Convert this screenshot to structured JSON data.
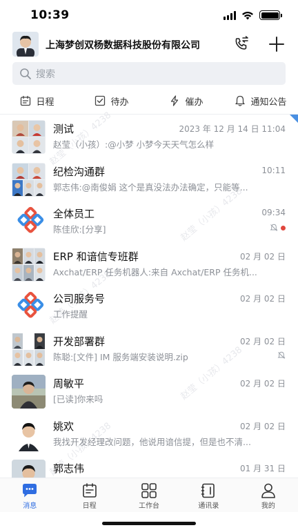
{
  "status_bar": {
    "time": "10:39"
  },
  "header": {
    "company_name": "上海梦创双杨数据科技股份有限公司",
    "call_icon": "phone-transfer-icon",
    "add_icon": "plus-icon"
  },
  "search": {
    "placeholder": "搜索"
  },
  "quick_actions": [
    {
      "label": "日程",
      "icon": "calendar-icon"
    },
    {
      "label": "待办",
      "icon": "todo-check-icon"
    },
    {
      "label": "催办",
      "icon": "lightning-icon"
    },
    {
      "label": "通知公告",
      "icon": "bell-icon"
    }
  ],
  "conversations": [
    {
      "title": "测试",
      "time": "2023 年 12 月 14 日 11:04",
      "preview": "赵莹（小孩）:@小梦 小梦今天天气怎么样"
    },
    {
      "title": "纪检沟通群",
      "time": "10:11",
      "preview": "郭志伟:@南俊娟  这个是真没法办法确定，只能等..."
    },
    {
      "title": "全体员工",
      "time": "09:34",
      "preview": "陈佳欣:[分享]"
    },
    {
      "title": "ERP 和谙信专班群",
      "time": "02 月 02 日",
      "preview": "Axchat/ERP 任务机器人:来自 Axchat/ERP 任务机..."
    },
    {
      "title": "公司服务号",
      "time": "02 月 02 日",
      "preview": "工作提醒"
    },
    {
      "title": "开发部署群",
      "time": "02 月 02 日",
      "preview": "陈聪:[文件] IM 服务端安装说明.zip"
    },
    {
      "title": "周敏平",
      "time": "02 月 02 日",
      "preview": "[已读]你来吗"
    },
    {
      "title": "姚欢",
      "time": "02 月 02 日",
      "preview": "我找开发经理改问题，他说用谙信提，但是也不清..."
    },
    {
      "title": "郭志伟",
      "time": "01 月 31 日",
      "preview": ""
    }
  ],
  "watermark": "赵莹（小孩）4238",
  "tabbar": [
    {
      "label": "消息",
      "icon": "chat-bubble-icon",
      "active": true
    },
    {
      "label": "日程",
      "icon": "calendar-icon",
      "active": false
    },
    {
      "label": "工作台",
      "icon": "grid-icon",
      "active": false
    },
    {
      "label": "通讯录",
      "icon": "contacts-book-icon",
      "active": false
    },
    {
      "label": "我的",
      "icon": "person-icon",
      "active": false
    }
  ],
  "colors": {
    "accent": "#2f6de1",
    "unread_dot": "#e0473d",
    "logo_red": "#e8533f",
    "logo_blue": "#3a8ee6"
  }
}
